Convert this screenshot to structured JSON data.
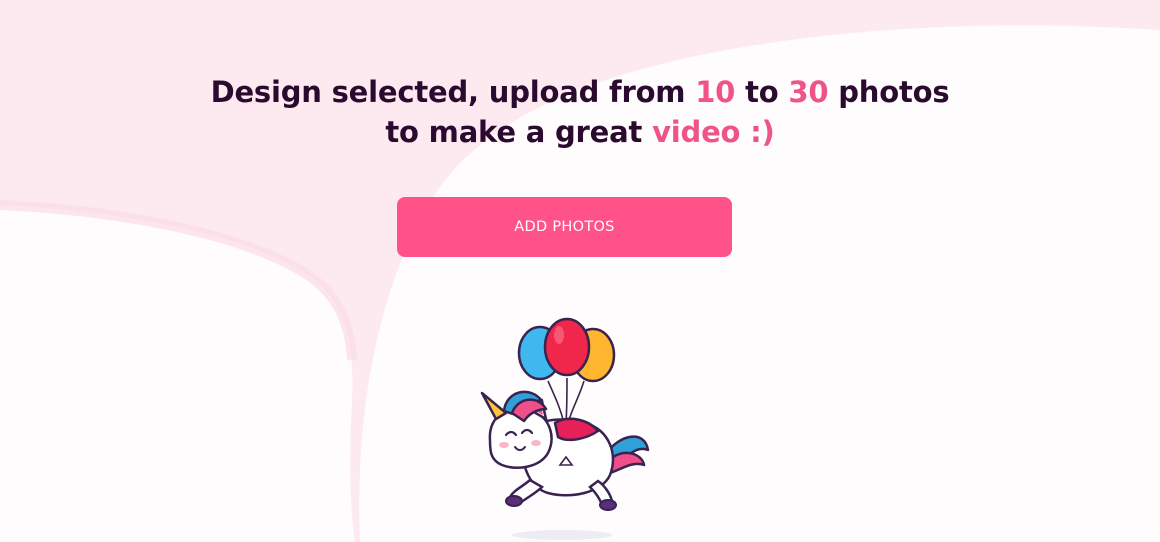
{
  "headline": {
    "line1_a": "Design selected, upload from ",
    "line1_num1": "10",
    "line1_b": " to ",
    "line1_num2": "30",
    "line1_c": " photos",
    "line2_a": "to make a great ",
    "line2_hl": "video :)"
  },
  "actions": {
    "add_photos_label": "ADD PHOTOS"
  },
  "colors": {
    "heading": "#2a0a2e",
    "accent": "#f0538a",
    "button": "#ff5289",
    "background_pink": "#fde9f0",
    "background_white": "#fefcfd"
  },
  "illustration": {
    "icon": "unicorn-with-balloons-illustration"
  }
}
